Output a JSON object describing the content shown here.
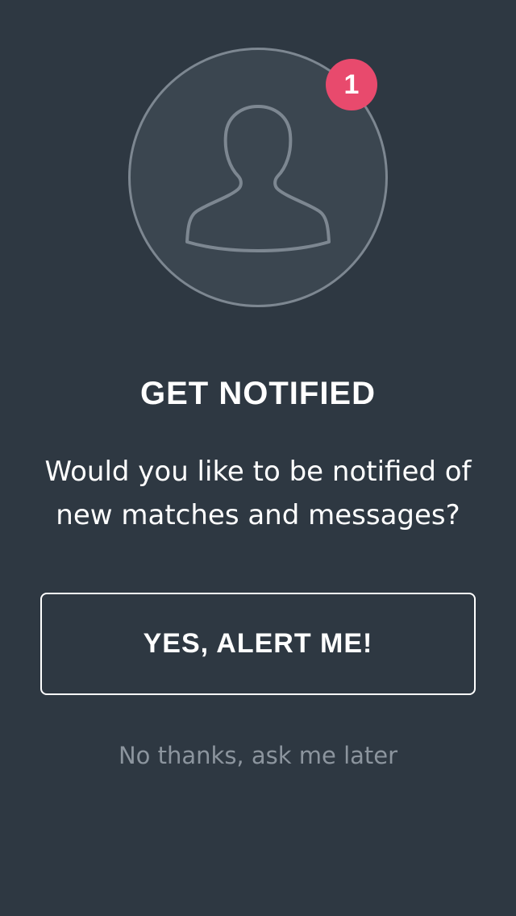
{
  "avatar": {
    "icon": "user-silhouette-icon",
    "badge_count": "1"
  },
  "prompt": {
    "title": "GET NOTIFIED",
    "message": "Would you like to be notified of new matches and messages?",
    "confirm_label": "YES, ALERT ME!",
    "dismiss_label": "No thanks, ask me later"
  },
  "colors": {
    "background": "#2e3842",
    "avatar_fill": "#3b4650",
    "avatar_outline": "#7d8791",
    "badge": "#e84a6d",
    "muted_text": "#8c959e"
  }
}
